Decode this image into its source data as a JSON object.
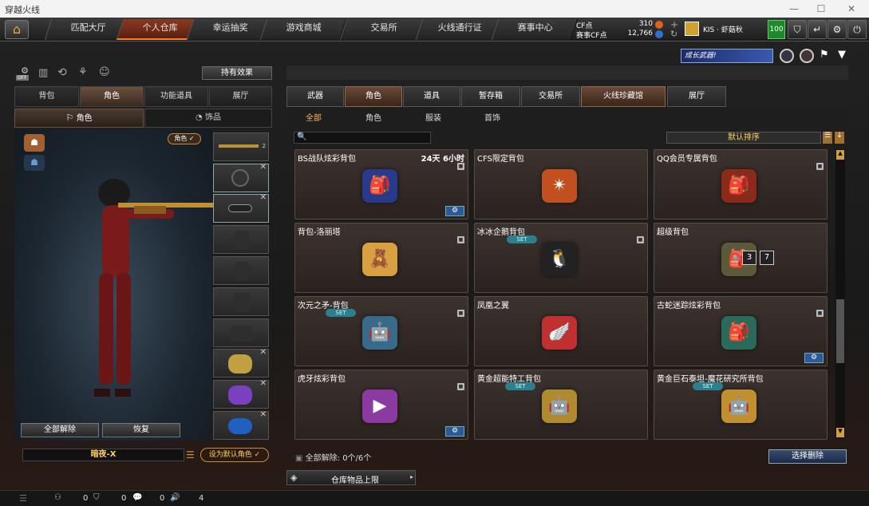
{
  "window": {
    "title": "穿越火线",
    "minimize": "—",
    "maximize": "☐",
    "close": "✕"
  },
  "topnav": {
    "tabs": [
      "匹配大厅",
      "个人仓库",
      "幸运抽奖",
      "游戏商城",
      "交易所",
      "火线通行证",
      "赛事中心"
    ],
    "active_tab": "个人仓库",
    "cf_label": "CF点",
    "cf_value": "310",
    "event_cf_label": "赛事CF点",
    "event_cf_value": "12,766",
    "clan": "KIS",
    "player": "虾菇秋",
    "level": "100"
  },
  "left": {
    "effects_button": "持有效果",
    "off_badge": "OFF",
    "tabs": [
      "背包",
      "角色",
      "功能道具",
      "展厅"
    ],
    "active_tab": "角色",
    "subtabs": [
      "角色",
      "饰品"
    ],
    "role_badge": "角色 ✓",
    "unequip_all": "全部解除",
    "restore": "恢复",
    "character_name": "暗夜-X",
    "set_default": "设为默认角色 ✓",
    "weapon_count": "2"
  },
  "banner": {
    "text": "成长武器!"
  },
  "right": {
    "tabs": [
      "武器",
      "角色",
      "道具",
      "暂存箱",
      "交易所",
      "火线珍藏馆",
      "展厅"
    ],
    "active_tab": "角色",
    "highlight_tab": "火线珍藏馆",
    "subtabs": [
      "全部",
      "角色",
      "服装",
      "首饰"
    ],
    "active_subtab": "全部",
    "search_placeholder": "",
    "sort": "默认排序",
    "items": [
      {
        "name": "BS战队炫彩背包",
        "time": "24天 6小时",
        "set": false,
        "gear": true,
        "lock": true,
        "icon": "🎒",
        "color": "#2a3a8a"
      },
      {
        "name": "CFS限定背包",
        "time": "",
        "set": false,
        "gear": false,
        "lock": false,
        "icon": "✴",
        "color": "#c05020"
      },
      {
        "name": "QQ会员专属背包",
        "time": "",
        "set": false,
        "gear": false,
        "lock": true,
        "icon": "🎒",
        "color": "#8a2a1a"
      },
      {
        "name": "背包-洛丽塔",
        "time": "",
        "set": false,
        "gear": false,
        "lock": true,
        "icon": "🧸",
        "color": "#d8a040"
      },
      {
        "name": "冰冰企鹅背包",
        "time": "",
        "set": true,
        "gear": false,
        "lock": true,
        "icon": "🐧",
        "color": "#222"
      },
      {
        "name": "超级背包",
        "time": "",
        "set": false,
        "gear": false,
        "lock": false,
        "icon": "🎒",
        "color": "#5a5a3a"
      },
      {
        "name": "次元之矛-背包",
        "time": "",
        "set": true,
        "gear": false,
        "lock": true,
        "icon": "🤖",
        "color": "#3a6a8a"
      },
      {
        "name": "凤凰之翼",
        "time": "",
        "set": false,
        "gear": false,
        "lock": false,
        "icon": "🪽",
        "color": "#c03030"
      },
      {
        "name": "古蛇迷踪炫彩背包",
        "time": "",
        "set": false,
        "gear": true,
        "lock": true,
        "icon": "🎒",
        "color": "#2a6a5a"
      },
      {
        "name": "虎牙炫彩背包",
        "time": "",
        "set": false,
        "gear": true,
        "lock": true,
        "icon": "▶",
        "color": "#8a3aa0"
      },
      {
        "name": "黄金超能特工背包",
        "time": "",
        "set": true,
        "gear": false,
        "lock": false,
        "icon": "🤖",
        "color": "#b08a30"
      },
      {
        "name": "黄金巨石泰坦-魔花研究所背包",
        "time": "",
        "set": true,
        "gear": false,
        "lock": false,
        "icon": "🤖",
        "color": "#c09030"
      }
    ],
    "super_backpack_tags": [
      "3",
      "7"
    ],
    "unequip_info": "全部解除: 0个/6个",
    "select_delete": "选择删除",
    "storage_limit": "仓库物品上限"
  },
  "statusbar": {
    "a": "0",
    "b": "0",
    "c": "0",
    "d": "4"
  }
}
